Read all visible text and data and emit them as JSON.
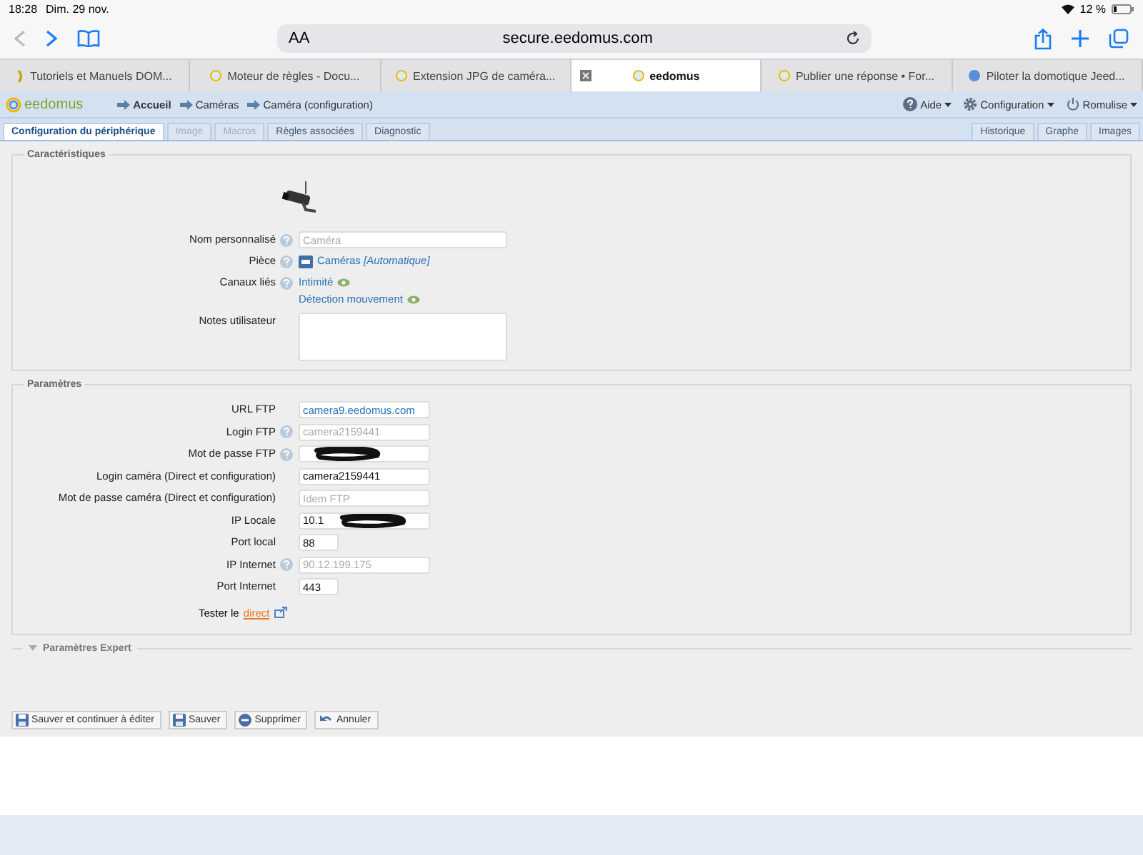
{
  "status_bar": {
    "time": "18:28",
    "date": "Dim. 29 nov.",
    "battery": "12 %"
  },
  "browser": {
    "text_size": "AA",
    "address": "secure.eedomus.com"
  },
  "browser_tabs": [
    {
      "title": "Tutoriels et Manuels DOM...",
      "selected": false,
      "kind": "d"
    },
    {
      "title": "Moteur de règles - Docu...",
      "selected": false,
      "kind": "e"
    },
    {
      "title": "Extension JPG de caméra...",
      "selected": false,
      "kind": "e"
    },
    {
      "title": "eedomus",
      "selected": true,
      "kind": "e"
    },
    {
      "title": "Publier une réponse • For...",
      "selected": false,
      "kind": "e"
    },
    {
      "title": "Piloter la domotique Jeed...",
      "selected": false,
      "kind": "j"
    }
  ],
  "nav": {
    "logo": "eedomus",
    "breadcrumb": [
      {
        "label": "Accueil",
        "bold": true
      },
      {
        "label": "Caméras",
        "bold": false
      },
      {
        "label": "Caméra (configuration)",
        "bold": false
      }
    ],
    "menus": [
      {
        "label": "Aide",
        "kind": "help"
      },
      {
        "label": "Configuration",
        "kind": "gear"
      },
      {
        "label": "Romulise",
        "kind": "power"
      }
    ]
  },
  "tabs": [
    {
      "label": "Configuration du périphérique",
      "selected": true,
      "disabled": false
    },
    {
      "label": "Image",
      "selected": false,
      "disabled": true
    },
    {
      "label": "Macros",
      "selected": false,
      "disabled": true
    },
    {
      "label": "Règles associées",
      "selected": false,
      "disabled": false
    },
    {
      "label": "Diagnostic",
      "selected": false,
      "disabled": false
    }
  ],
  "right_tabs": [
    {
      "label": "Historique"
    },
    {
      "label": "Graphe"
    },
    {
      "label": "Images"
    }
  ],
  "characteristics": {
    "legend": "Caractéristiques",
    "rows": [
      {
        "kind": "input",
        "label": "Nom personnalisé",
        "help": true,
        "placeholder": "Caméra"
      },
      {
        "kind": "room",
        "label": "Pièce",
        "help": true,
        "room": "Caméras",
        "suffix": "[Automatique]"
      },
      {
        "kind": "links",
        "label": "Canaux liés",
        "help": true,
        "links": [
          "Intimité",
          "Détection mouvement"
        ]
      },
      {
        "kind": "textarea",
        "label": "Notes utilisateur",
        "help": false
      }
    ]
  },
  "parameters": {
    "legend": "Paramètres",
    "rows": [
      {
        "kind": "input",
        "label": "URL FTP",
        "help": false,
        "value": "camera9.eedomus.com",
        "link_style": true
      },
      {
        "kind": "input",
        "label": "Login FTP",
        "help": true,
        "placeholder": "camera2159441"
      },
      {
        "kind": "input",
        "label": "Mot de passe FTP",
        "help": true,
        "value": "",
        "redacted": true
      },
      {
        "kind": "input",
        "label": "Login caméra (Direct et configuration)",
        "help": false,
        "value": "camera2159441"
      },
      {
        "kind": "input",
        "label": "Mot de passe caméra (Direct et configuration)",
        "help": false,
        "placeholder": "Idem FTP"
      },
      {
        "kind": "input",
        "label": "IP Locale",
        "help": false,
        "value": "10.1",
        "redacted": true
      },
      {
        "kind": "short",
        "label": "Port local",
        "help": false,
        "value": "88"
      },
      {
        "kind": "input",
        "label": "IP Internet",
        "help": true,
        "placeholder": "90.12.199.175"
      },
      {
        "kind": "short",
        "label": "Port Internet",
        "help": false,
        "value": "443"
      },
      {
        "kind": "test",
        "label": "Tester le",
        "link": "direct"
      }
    ]
  },
  "expert": {
    "legend": "Paramètres Expert",
    "expanded": false
  },
  "buttons": [
    {
      "label": "Sauver et continuer à éditer",
      "kind": "save"
    },
    {
      "label": "Sauver",
      "kind": "save"
    },
    {
      "label": "Supprimer",
      "kind": "delete"
    },
    {
      "label": "Annuler",
      "kind": "undo"
    }
  ]
}
